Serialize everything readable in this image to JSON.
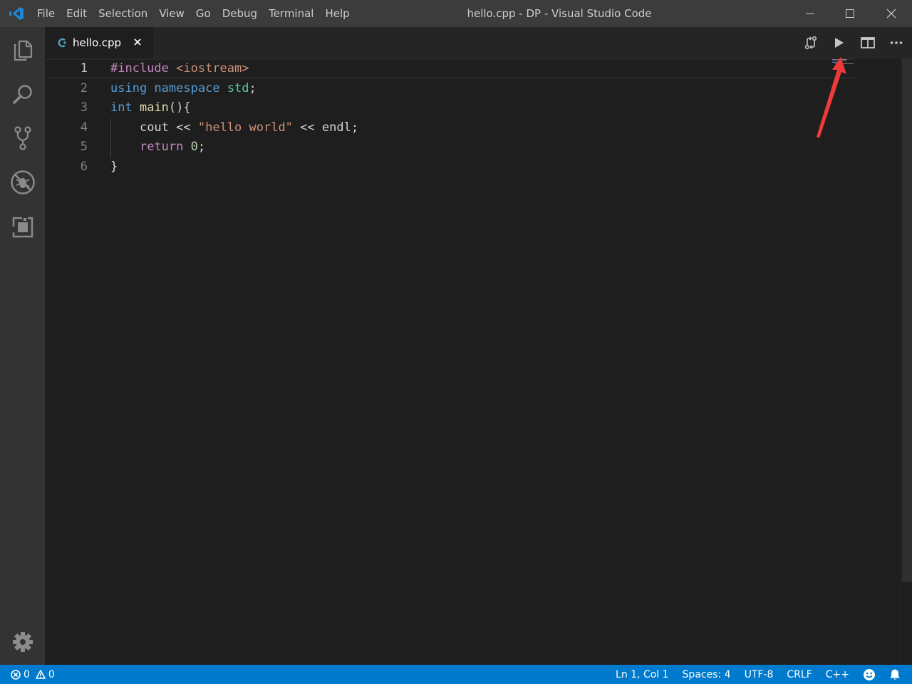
{
  "window": {
    "title": "hello.cpp - DP - Visual Studio Code",
    "menu": [
      "File",
      "Edit",
      "Selection",
      "View",
      "Go",
      "Debug",
      "Terminal",
      "Help"
    ]
  },
  "activity_bar": {
    "icons": [
      "files-icon",
      "search-icon",
      "source-control-icon",
      "debug-icon",
      "extensions-icon",
      "gear-icon"
    ]
  },
  "tab": {
    "label": "hello.cpp",
    "icon": "cpp-file-icon"
  },
  "editor": {
    "line_numbers": [
      "1",
      "2",
      "3",
      "4",
      "5",
      "6"
    ],
    "active_line": 1,
    "tokens": {
      "l1_pre": "#include",
      "l1_inc": "<iostream>",
      "l2_using": "using",
      "l2_ns_kw": "namespace",
      "l2_std": "std",
      "l2_semi": ";",
      "l3_int": "int",
      "l3_main": "main",
      "l3_rest": "(){",
      "l4_cout": "cout <<",
      "l4_str": "\"hello world\"",
      "l4_rest": "<< endl;",
      "l5_return": "return",
      "l5_zero": "0",
      "l5_semi": ";",
      "l6_brace": "}"
    }
  },
  "editor_actions": [
    "compare-icon",
    "run-icon",
    "split-editor-icon",
    "more-actions-icon"
  ],
  "status_bar": {
    "errors": "0",
    "warnings": "0",
    "position": "Ln 1, Col 1",
    "spaces": "Spaces: 4",
    "encoding": "UTF-8",
    "eol": "CRLF",
    "language": "C++"
  },
  "colors": {
    "titlebar": "#3c3c3c",
    "activitybar": "#333333",
    "editor_bg": "#1e1e1e",
    "statusbar": "#007acc",
    "annotation_arrow": "#f03a3a"
  }
}
